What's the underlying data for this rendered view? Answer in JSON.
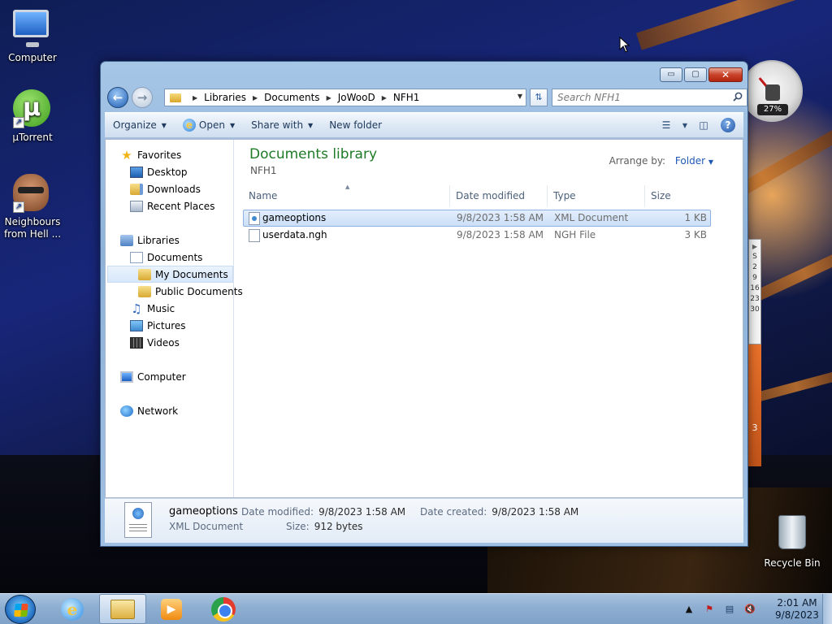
{
  "desktop": {
    "icons": [
      {
        "label": "Computer"
      },
      {
        "label": "µTorrent",
        "glyph": "µ"
      },
      {
        "label": "Neighbours from Hell ..."
      },
      {
        "label": "Recycle Bin"
      }
    ],
    "gadgets": {
      "meter_percent": "27%",
      "calendar_letters": [
        "S",
        "2",
        "9",
        "16",
        "23",
        "30"
      ],
      "calendar_extra": "3"
    }
  },
  "window": {
    "caption_buttons": {
      "minimize": "▭",
      "maximize": "▢",
      "close": "✕"
    },
    "address": {
      "crumbs": [
        "Libraries",
        "Documents",
        "JoWooD",
        "NFH1"
      ]
    },
    "search": {
      "placeholder": "Search NFH1"
    },
    "toolbar": {
      "organize": "Organize",
      "open": "Open",
      "share_with": "Share with",
      "new_folder": "New folder"
    },
    "nav_pane": {
      "favorites": "Favorites",
      "desktop": "Desktop",
      "downloads": "Downloads",
      "recent_places": "Recent Places",
      "libraries": "Libraries",
      "documents": "Documents",
      "my_documents": "My Documents",
      "public_documents": "Public Documents",
      "music": "Music",
      "pictures": "Pictures",
      "videos": "Videos",
      "computer": "Computer",
      "network": "Network"
    },
    "main": {
      "library_title": "Documents library",
      "library_subtitle": "NFH1",
      "arrange_by_label": "Arrange by:",
      "arrange_by_value": "Folder",
      "columns": [
        "Name",
        "Date modified",
        "Type",
        "Size"
      ],
      "files": [
        {
          "name": "gameoptions",
          "date_modified": "9/8/2023 1:58 AM",
          "type": "XML Document",
          "size": "1 KB",
          "selected": true
        },
        {
          "name": "userdata.ngh",
          "date_modified": "9/8/2023 1:58 AM",
          "type": "NGH File",
          "size": "3 KB",
          "selected": false
        }
      ]
    },
    "details": {
      "name": "gameoptions",
      "type": "XML Document",
      "date_modified_label": "Date modified:",
      "date_modified": "9/8/2023 1:58 AM",
      "date_created_label": "Date created:",
      "date_created": "9/8/2023 1:58 AM",
      "size_label": "Size:",
      "size": "912 bytes"
    }
  },
  "taskbar": {
    "clock_time": "2:01 AM",
    "clock_date": "9/8/2023",
    "pinned": [
      "internet-explorer",
      "windows-explorer",
      "windows-media-player",
      "google-chrome"
    ],
    "active": "windows-explorer"
  }
}
